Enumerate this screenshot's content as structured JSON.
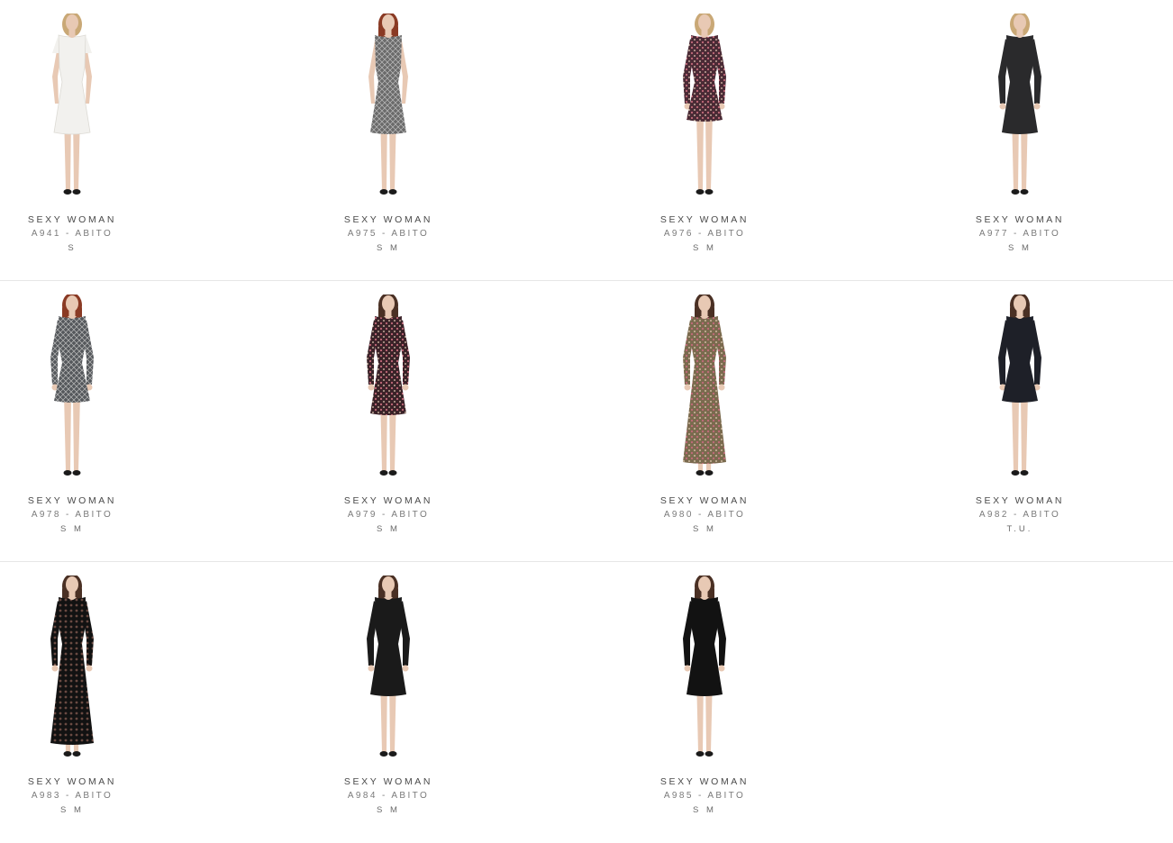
{
  "products": [
    {
      "brand": "SEXY WOMAN",
      "name": "A941 - ABITO",
      "sizes": "S",
      "dress_color": "#f2f1ee",
      "pattern": "plain",
      "sleeve": "short",
      "length": "knee",
      "hair": "blonde"
    },
    {
      "brand": "SEXY WOMAN",
      "name": "A975 - ABITO",
      "sizes": "S M",
      "dress_color": "#6a6a6a",
      "pattern": "knit",
      "sleeve": "none",
      "length": "knee",
      "hair": "red"
    },
    {
      "brand": "SEXY WOMAN",
      "name": "A976 - ABITO",
      "sizes": "S M",
      "dress_color": "#4a2a35",
      "pattern": "print",
      "sleeve": "long",
      "length": "short",
      "hair": "blonde"
    },
    {
      "brand": "SEXY WOMAN",
      "name": "A977 - ABITO",
      "sizes": "S M",
      "dress_color": "#2a2a2c",
      "pattern": "plain",
      "sleeve": "long",
      "length": "knee",
      "hair": "blonde"
    },
    {
      "brand": "SEXY WOMAN",
      "name": "A978 - ABITO",
      "sizes": "S M",
      "dress_color": "#55585c",
      "pattern": "knit",
      "sleeve": "long",
      "length": "short",
      "hair": "red"
    },
    {
      "brand": "SEXY WOMAN",
      "name": "A979 - ABITO",
      "sizes": "S M",
      "dress_color": "#3a2228",
      "pattern": "print",
      "sleeve": "long",
      "length": "knee",
      "hair": "brown"
    },
    {
      "brand": "SEXY WOMAN",
      "name": "A980 - ABITO",
      "sizes": "S M",
      "dress_color": "#7a6a4e",
      "pattern": "print",
      "sleeve": "long",
      "length": "maxi",
      "hair": "brown"
    },
    {
      "brand": "SEXY WOMAN",
      "name": "A982 - ABITO",
      "sizes": "T.U.",
      "dress_color": "#1e2028",
      "pattern": "plain",
      "sleeve": "long",
      "length": "short",
      "hair": "brown"
    },
    {
      "brand": "SEXY WOMAN",
      "name": "A983 - ABITO",
      "sizes": "S M",
      "dress_color": "#121212",
      "pattern": "lace",
      "sleeve": "long",
      "length": "maxi",
      "hair": "brown"
    },
    {
      "brand": "SEXY WOMAN",
      "name": "A984 - ABITO",
      "sizes": "S M",
      "dress_color": "#1a1a1a",
      "pattern": "plain",
      "sleeve": "long",
      "length": "knee",
      "hair": "brown"
    },
    {
      "brand": "SEXY WOMAN",
      "name": "A985 - ABITO",
      "sizes": "S M",
      "dress_color": "#121212",
      "pattern": "plain",
      "sleeve": "long",
      "length": "knee",
      "hair": "brown"
    }
  ]
}
